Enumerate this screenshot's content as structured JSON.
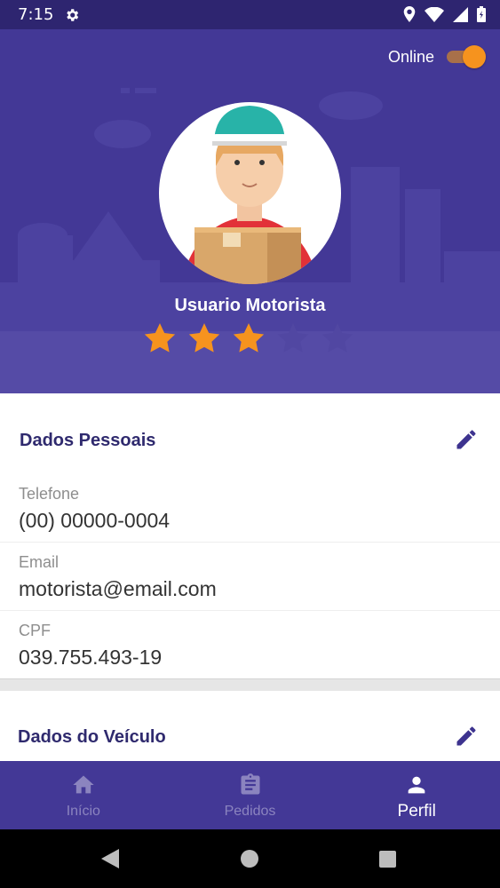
{
  "status_bar": {
    "time": "7:15"
  },
  "header": {
    "online_label": "Online",
    "online_enabled": true,
    "username": "Usuario Motorista",
    "rating": 3,
    "rating_max": 5,
    "accent_color": "#f6931e",
    "background_color": "#433896"
  },
  "personal": {
    "title": "Dados Pessoais",
    "fields": [
      {
        "label": "Telefone",
        "value": "(00) 00000-0004"
      },
      {
        "label": "Email",
        "value": "motorista@email.com"
      },
      {
        "label": "CPF",
        "value": "039.755.493-19"
      }
    ]
  },
  "vehicle": {
    "title": "Dados do Veículo"
  },
  "bottom_nav": {
    "items": [
      {
        "label": "Início",
        "icon": "home-icon",
        "active": false
      },
      {
        "label": "Pedidos",
        "icon": "clipboard-icon",
        "active": false
      },
      {
        "label": "Perfil",
        "icon": "person-icon",
        "active": true
      }
    ]
  },
  "system_nav": {
    "icons": [
      "back-icon",
      "home-circle-icon",
      "recents-icon"
    ]
  }
}
